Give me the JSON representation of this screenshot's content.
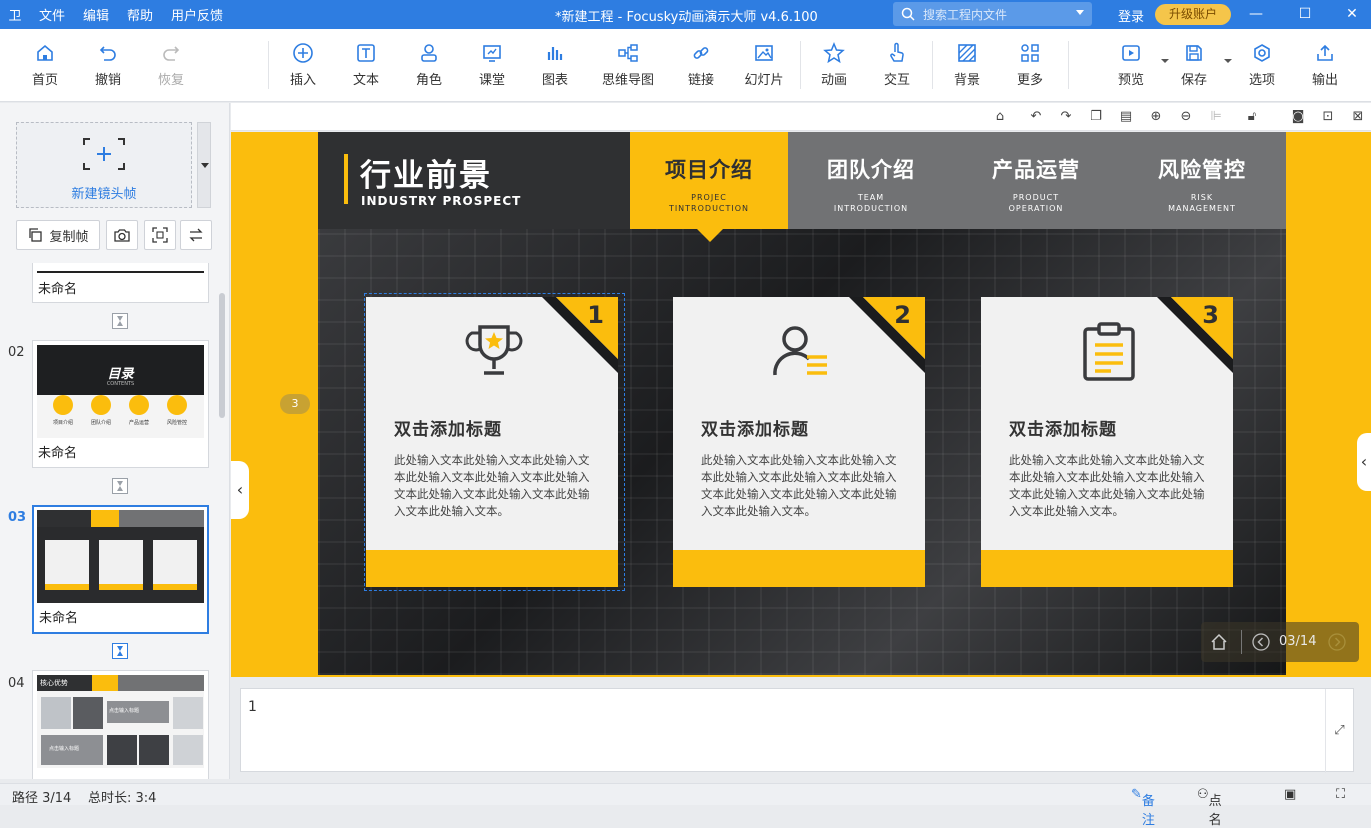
{
  "titlebar": {
    "logo": "卫",
    "menus": [
      "文件",
      "编辑",
      "帮助",
      "用户反馈"
    ],
    "title": "*新建工程 - Focusky动画演示大师  v4.6.100",
    "search_placeholder": "搜索工程内文件",
    "login": "登录",
    "upgrade": "升级账户",
    "accent": "#2e7de1"
  },
  "toolbar": {
    "home": "首页",
    "undo": "撤销",
    "redo": "恢复",
    "insert": "插入",
    "text": "文本",
    "role": "角色",
    "class": "课堂",
    "chart": "图表",
    "mindmap": "思维导图",
    "link": "链接",
    "slideshow": "幻灯片",
    "animation": "动画",
    "interaction": "交互",
    "background": "背景",
    "more": "更多",
    "preview": "预览",
    "save": "保存",
    "options": "选项",
    "export": "输出"
  },
  "leftpanel": {
    "new_frame": "新建镜头帧",
    "copy_frame": "复制帧",
    "slides": [
      {
        "num": "",
        "name": "未命名"
      },
      {
        "num": "02",
        "name": "未命名",
        "thumb_title": "目录",
        "thumb_sub": "CONTENTS",
        "thumb_items": [
          "项目介绍",
          "团队介绍",
          "产品运营",
          "风险管控"
        ]
      },
      {
        "num": "03",
        "name": "未命名"
      },
      {
        "num": "04",
        "name": "",
        "thumb_title": "核心优势",
        "thumb_caption_a": "点击输入标题",
        "thumb_caption_b": "点击输入标题"
      }
    ]
  },
  "slide": {
    "title_zh": "行业前景",
    "title_en": "INDUSTRY PROSPECT",
    "tabs": [
      {
        "zh": "项目介绍",
        "en1": "PROJEC",
        "en2": "TINTRODUCTION"
      },
      {
        "zh": "团队介绍",
        "en1": "TEAM",
        "en2": "INTRODUCTION"
      },
      {
        "zh": "产品运营",
        "en1": "PRODUCT",
        "en2": "OPERATION"
      },
      {
        "zh": "风险管控",
        "en1": "RISK",
        "en2": "MANAGEMENT"
      }
    ],
    "cards": [
      {
        "num": "1",
        "icon": "trophy-icon",
        "title": "双击添加标题",
        "body": "此处输入文本此处输入文本此处输入文本此处输入文本此处输入文本此处输入文本此处输入文本此处输入文本此处输入文本此处输入文本。"
      },
      {
        "num": "2",
        "icon": "user-list-icon",
        "title": "双击添加标题",
        "body": "此处输入文本此处输入文本此处输入文本此处输入文本此处输入文本此处输入文本此处输入文本此处输入文本此处输入文本此处输入文本。"
      },
      {
        "num": "3",
        "icon": "clipboard-icon",
        "title": "双击添加标题",
        "body": "此处输入文本此处输入文本此处输入文本此处输入文本此处输入文本此处输入文本此处输入文本此处输入文本此处输入文本此处输入文本。"
      }
    ],
    "path_badge": "3",
    "page_counter": "03/14",
    "accent": "#fbbd0d",
    "dark": "#2f3032"
  },
  "notes": {
    "text": "1"
  },
  "status": {
    "path": "路径 3/14",
    "duration": "总时长: 3:4",
    "notes_label": "备注",
    "rollcall": "点名"
  }
}
